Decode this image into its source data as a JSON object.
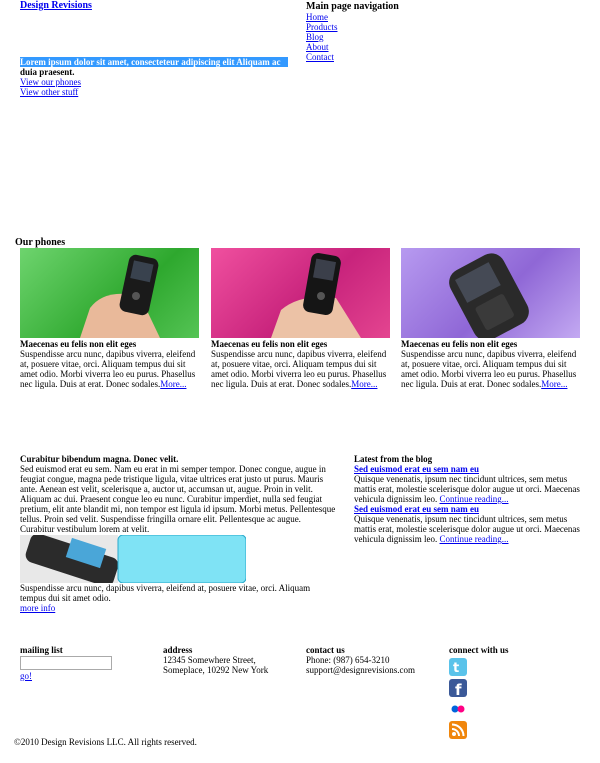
{
  "brand": {
    "name": "Design Revisions"
  },
  "nav": {
    "title": "Main page navigation",
    "items": [
      "Home",
      "Products",
      "Blog",
      "About",
      "Contact"
    ]
  },
  "hero": {
    "headline": "Lorem ipsum dolor sit amet, consecteteur adipiscing elit Aliquam ac",
    "headline_rest": "duia praesent.",
    "links": [
      "View our phones",
      "View other stuff"
    ]
  },
  "phones": {
    "title": "Our phones",
    "items": [
      {
        "name": "Maecenas eu felis non elit eges",
        "desc": "Suspendisse arcu nunc, dapibus viverra, eleifend at, posuere vitae, orci. Aliquam tempus dui sit amet odio. Morbi viverra leo eu purus. Phasellus nec ligula. Duis at erat. Donec sodales.",
        "more": "More...",
        "bg": "#3fb83f"
      },
      {
        "name": "Maecenas eu felis non elit eges",
        "desc": "Suspendisse arcu nunc, dapibus viverra, eleifend at, posuere vitae, orci. Aliquam tempus dui sit amet odio. Morbi viverra leo eu purus. Phasellus nec ligula. Duis at erat. Donec sodales.",
        "more": "More...",
        "bg": "#d42f8a"
      },
      {
        "name": "Maecenas eu felis non elit eges",
        "desc": "Suspendisse arcu nunc, dapibus viverra, eleifend at, posuere vitae, orci. Aliquam tempus dui sit amet odio. Morbi viverra leo eu purus. Phasellus nec ligula. Duis at erat. Donec sodales.",
        "more": "More...",
        "bg": "#a07ad8"
      }
    ]
  },
  "feature": {
    "title": "Curabitur bibendum magna. Donec velit.",
    "body": "Sed euismod erat eu sem. Nam eu erat in mi semper tempor. Donec congue, augue in feugiat congue, magna pede tristique ligula, vitae ultrices erat justo ut purus. Mauris ante. Aenean est velit, scelerisque a, auctor ut, accumsan ut, augue. Proin in velit. Aliquam ac dui. Praesent congue leo eu nunc. Curabitur imperdiet, nulla sed feugiat pretium, elit ante blandit mi, non tempor est ligula id ipsum. Morbi metus. Pellentesque tellus. Proin sed velit. Suspendisse fringilla ornare elit. Pellentesque ac augue. Curabitur vestibulum lorem at velit.",
    "caption": "Suspendisse arcu nunc, dapibus viverra, eleifend at, posuere vitae, orci. Aliquam tempus dui sit amet odio.",
    "more": "more info"
  },
  "blog": {
    "title": "Latest from the blog",
    "posts": [
      {
        "title": "Sed euismod erat eu sem nam eu",
        "body": "Quisque venenatis, ipsum nec tincidunt ultrices, sem metus mattis erat, molestie scelerisque dolor augue ut orci. Maecenas vehicula dignissim leo.",
        "more": "Continue reading..."
      },
      {
        "title": "Sed euismod erat eu sem nam eu",
        "body": "Quisque venenatis, ipsum nec tincidunt ultrices, sem metus mattis erat, molestie scelerisque dolor augue ut orci. Maecenas vehicula dignissim leo.",
        "more": "Continue reading..."
      }
    ]
  },
  "footer": {
    "mailing": {
      "title": "mailing list",
      "go": "go!"
    },
    "address": {
      "title": "address",
      "line1": "12345 Somewhere Street,",
      "line2": "Someplace, 10292 New York"
    },
    "contact": {
      "title": "contact us",
      "phone": "Phone: (987) 654-3210",
      "email": "support@designrevisions.com"
    },
    "connect": {
      "title": "connect with us",
      "icons": [
        "twitter-icon",
        "facebook-icon",
        "flickr-icon",
        "rss-icon"
      ]
    },
    "copyright": "©2010 Design Revisions LLC. All rights reserved."
  }
}
